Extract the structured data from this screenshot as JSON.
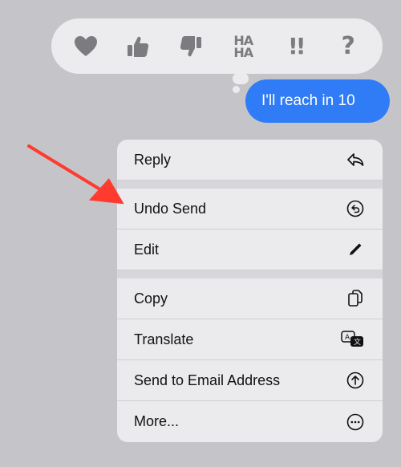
{
  "reactions": [
    {
      "name": "heart"
    },
    {
      "name": "thumbs-up"
    },
    {
      "name": "thumbs-down"
    },
    {
      "name": "haha",
      "label_top": "HA",
      "label_bottom": "HA"
    },
    {
      "name": "exclamation",
      "label": "!!"
    },
    {
      "name": "question",
      "label": "?"
    }
  ],
  "message": {
    "text": "I'll reach in 10",
    "color": "#2f7cf6"
  },
  "menu": {
    "items": [
      {
        "label": "Reply",
        "icon": "reply-arrow-icon"
      },
      {
        "label": "Undo Send",
        "icon": "undo-circle-icon"
      },
      {
        "label": "Edit",
        "icon": "pencil-icon"
      },
      {
        "label": "Copy",
        "icon": "copy-icon"
      },
      {
        "label": "Translate",
        "icon": "translate-icon"
      },
      {
        "label": "Send to Email Address",
        "icon": "arrow-up-circle-icon"
      },
      {
        "label": "More...",
        "icon": "more-ellipsis-icon"
      }
    ]
  },
  "annotation": {
    "color": "#ff3b30",
    "target": "Undo Send"
  }
}
